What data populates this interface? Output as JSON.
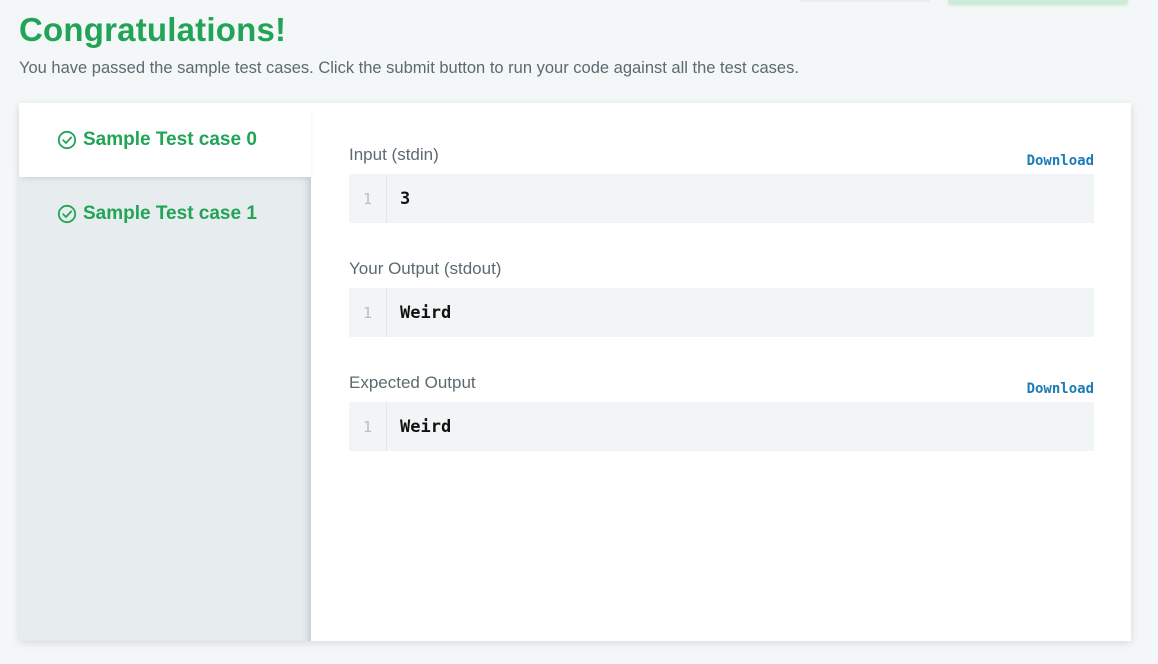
{
  "header": {
    "title": "Congratulations!",
    "subtitle": "You have passed the sample test cases. Click the submit button to run your code against all the test cases."
  },
  "tabs": [
    {
      "label": "Sample Test case 0",
      "active": true,
      "icon": "check-circle-icon"
    },
    {
      "label": "Sample Test case 1",
      "active": false,
      "icon": "check-circle-icon"
    }
  ],
  "sections": {
    "input": {
      "label": "Input (stdin)",
      "download": "Download",
      "line_number": "1",
      "content": "3"
    },
    "your_output": {
      "label": "Your Output (stdout)",
      "line_number": "1",
      "content": "Weird"
    },
    "expected": {
      "label": "Expected Output",
      "download": "Download",
      "line_number": "1",
      "content": "Weird"
    }
  },
  "colors": {
    "success": "#22a456",
    "link": "#1b7bb8",
    "text_muted": "#5c6a70"
  }
}
